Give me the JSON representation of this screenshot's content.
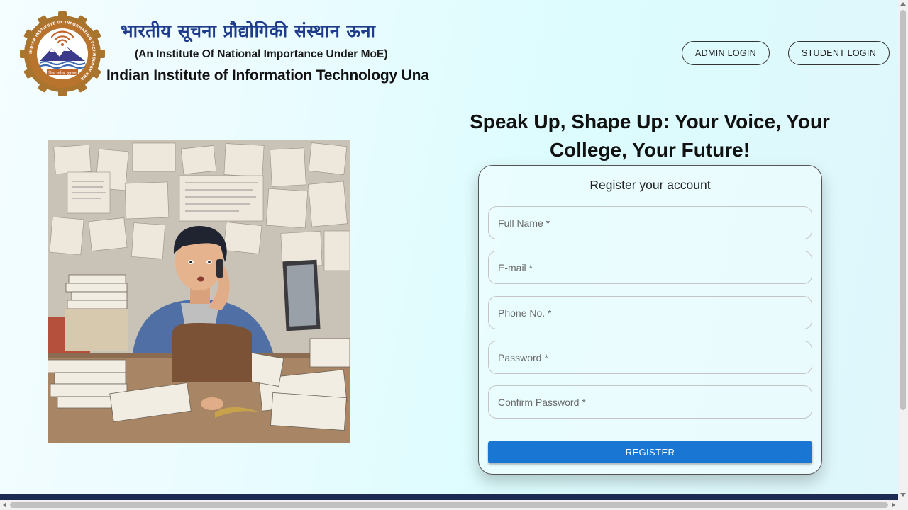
{
  "header": {
    "logo_icon": "iiit-una-emblem",
    "logo_text": "INDIAN INSTITUTE OF INFORMATION TECHNOLOGY UNA",
    "hindi_title": "भारतीय सूचना प्रौद्योगिकी संस्थान ऊना",
    "subtitle": "(An Institute Of National Importance Under MoE)",
    "institute_name": "Indian Institute of Information Technology Una",
    "admin_login_label": "ADMIN LOGIN",
    "student_login_label": "STUDENT LOGIN"
  },
  "hero": {
    "illustration": "student-on-phone-at-cluttered-desk",
    "tagline": "Speak Up, Shape Up: Your Voice, Your College, Your Future!"
  },
  "form": {
    "title": "Register your account",
    "full_name_placeholder": "Full Name *",
    "email_placeholder": "E-mail *",
    "phone_placeholder": "Phone No. *",
    "password_placeholder": "Password *",
    "confirm_password_placeholder": "Confirm Password *",
    "register_label": "REGISTER"
  },
  "colors": {
    "brand_blue": "#1f3c8c",
    "primary_button": "#1976d2",
    "footer_bar": "#1d2a52",
    "logo_orange": "#c0652a"
  }
}
